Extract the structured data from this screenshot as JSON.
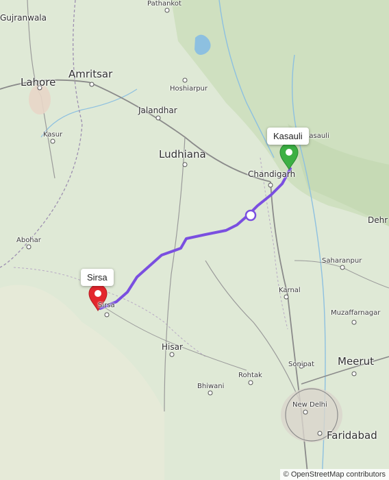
{
  "map": {
    "cities": [
      {
        "id": "gujranwala",
        "name": "Gujranwala"
      },
      {
        "id": "pathankot",
        "name": "Pathankot"
      },
      {
        "id": "amritsar",
        "name": "Amritsar"
      },
      {
        "id": "lahore",
        "name": "Lahore"
      },
      {
        "id": "hoshiarpur",
        "name": "Hoshiarpur"
      },
      {
        "id": "jalandhar",
        "name": "Jalandhar"
      },
      {
        "id": "kasur",
        "name": "Kasur"
      },
      {
        "id": "ludhiana",
        "name": "Ludhiana"
      },
      {
        "id": "chandigarh",
        "name": "Chandigarh"
      },
      {
        "id": "kasauli-town",
        "name": "Kasauli"
      },
      {
        "id": "dehradun",
        "name": "Dehr"
      },
      {
        "id": "abohar",
        "name": "Abohar"
      },
      {
        "id": "saharanpur",
        "name": "Saharanpur"
      },
      {
        "id": "sirsa-town",
        "name": "Sirsa"
      },
      {
        "id": "karnal",
        "name": "Karnal"
      },
      {
        "id": "muzaffarnagar",
        "name": "Muzaffarnagar"
      },
      {
        "id": "hisar",
        "name": "Hisar"
      },
      {
        "id": "meerut",
        "name": "Meerut"
      },
      {
        "id": "sonipat",
        "name": "Sonipat"
      },
      {
        "id": "rohtak",
        "name": "Rohtak"
      },
      {
        "id": "bhiwani",
        "name": "Bhiwani"
      },
      {
        "id": "new-delhi",
        "name": "New Delhi"
      },
      {
        "id": "faridabad",
        "name": "Faridabad"
      }
    ],
    "markers": {
      "start": {
        "label": "Kasauli",
        "color": "#3cb043"
      },
      "end": {
        "label": "Sirsa",
        "color": "#e3262d"
      }
    },
    "route_color": "#7a4fe0",
    "attribution": "© OpenStreetMap contributors"
  }
}
